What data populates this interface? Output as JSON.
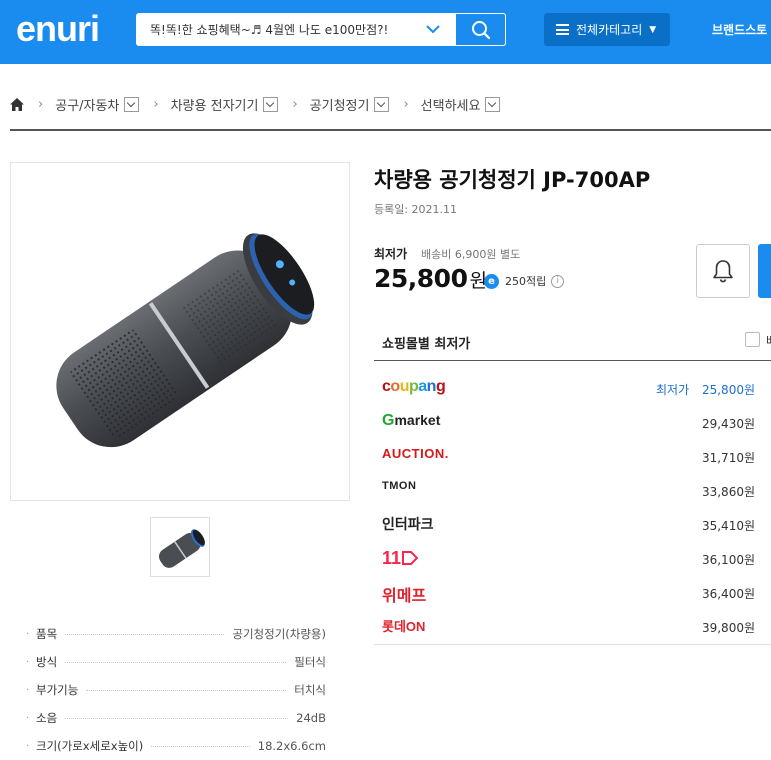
{
  "header": {
    "logo": "enuri",
    "search_text": "똑!똑!한 쇼핑혜택~♬ 4월엔 나도 e100만점?!",
    "category_label": "전체카테고리",
    "brand_link": "브랜드스토"
  },
  "breadcrumb": [
    "공구/자동차",
    "차량용 전자기기",
    "공기청정기",
    "선택하세요"
  ],
  "product": {
    "title": "차량용 공기청정기 JP-700AP",
    "reg_date": "등록일: 2021.11",
    "lowest_label": "최저가",
    "shipping": "배송비 6,900원 별도",
    "price": "25,800",
    "price_unit": "원",
    "emoney_badge": "e",
    "emoney": "250적립",
    "info": "i"
  },
  "specs": [
    {
      "label": "품목",
      "value": "공기청정기(차량용)"
    },
    {
      "label": "방식",
      "value": "필터식"
    },
    {
      "label": "부가기능",
      "value": "터치식"
    },
    {
      "label": "소음",
      "value": "24dB"
    },
    {
      "label": "크기(가로x세로x높이)",
      "value": "18.2x6.6cm"
    }
  ],
  "shops_header": {
    "label": "쇼핑몰별 최저가",
    "check_label": "배"
  },
  "shops": [
    {
      "name": "coupang",
      "price": "25,800원",
      "best_label": "최저가"
    },
    {
      "name": "Gmarket",
      "price": "29,430원"
    },
    {
      "name": "AUCTION.",
      "price": "31,710원"
    },
    {
      "name": "TMON",
      "price": "33,860원"
    },
    {
      "name": "인터파크",
      "price": "35,410원"
    },
    {
      "name": "11",
      "price": "36,100원"
    },
    {
      "name": "위메프",
      "price": "36,400원"
    },
    {
      "name": "롯데ON",
      "price": "39,800원"
    }
  ],
  "colors": {
    "brand": "#1a8cf0",
    "best_price": "#1a6fd0"
  }
}
